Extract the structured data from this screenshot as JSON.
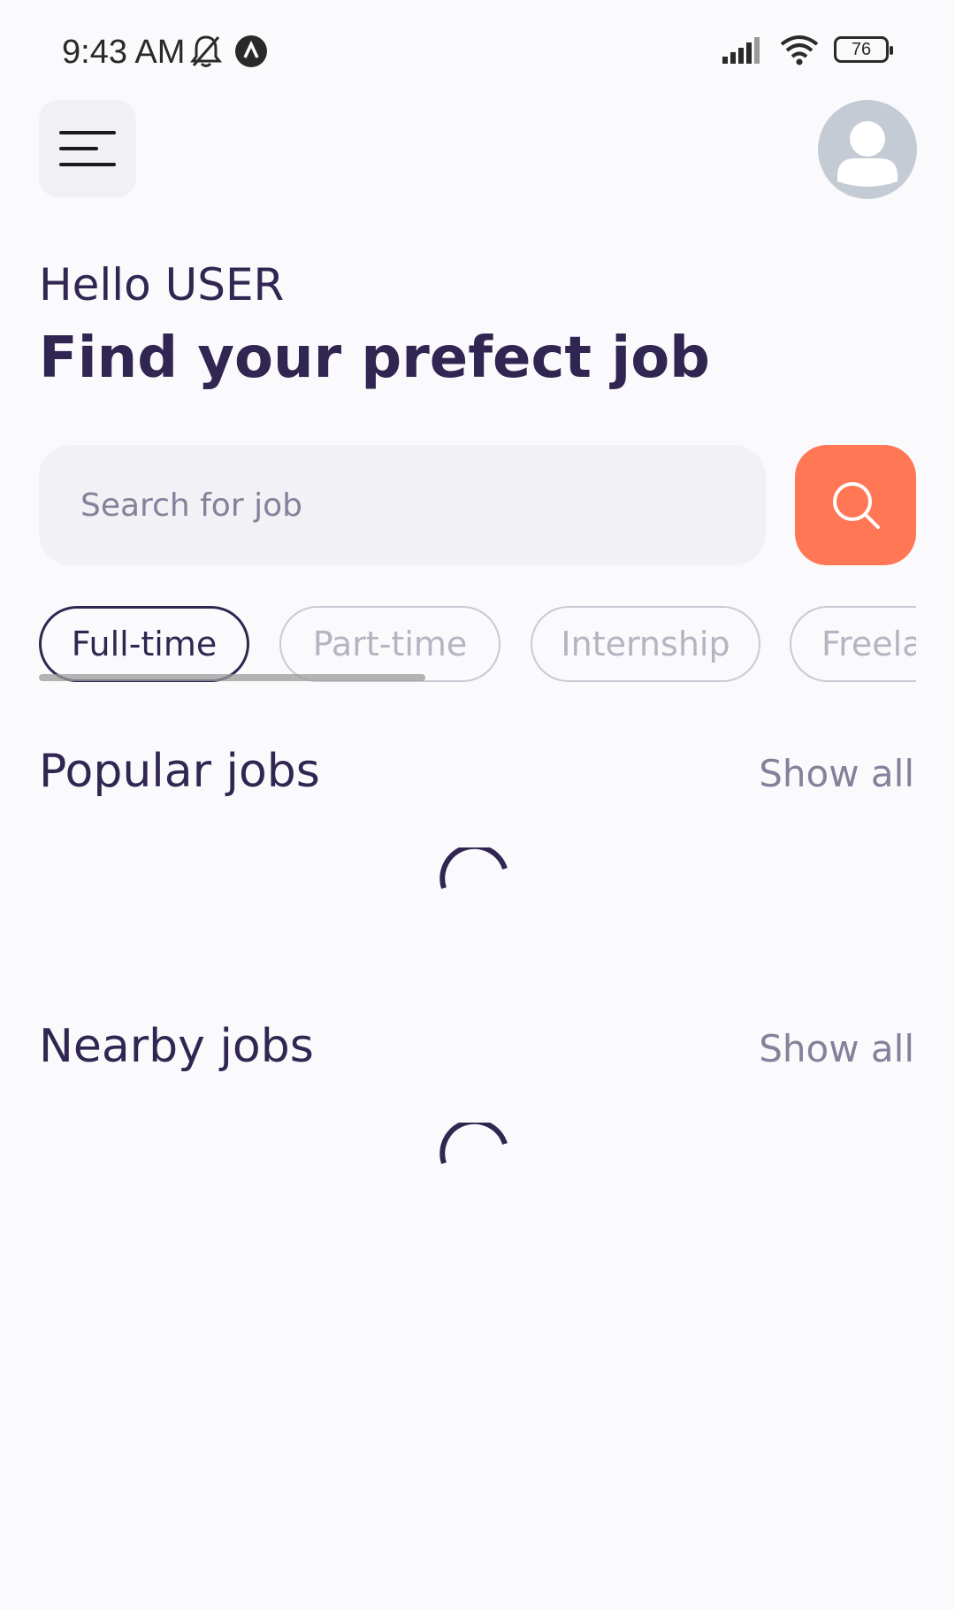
{
  "status_bar": {
    "time": "9:43 AM",
    "battery": "76"
  },
  "header": {
    "greeting": "Hello USER",
    "headline": "Find your prefect job"
  },
  "search": {
    "placeholder": "Search for job",
    "value": ""
  },
  "job_types": [
    {
      "label": "Full-time",
      "active": true
    },
    {
      "label": "Part-time",
      "active": false
    },
    {
      "label": "Internship",
      "active": false
    },
    {
      "label": "Freelance",
      "active": false
    }
  ],
  "sections": {
    "popular": {
      "title": "Popular jobs",
      "show_all": "Show all"
    },
    "nearby": {
      "title": "Nearby jobs",
      "show_all": "Show all"
    }
  },
  "colors": {
    "primary": "#312651",
    "accent": "#ff7754",
    "muted": "#83829a",
    "background": "#fafafc"
  }
}
